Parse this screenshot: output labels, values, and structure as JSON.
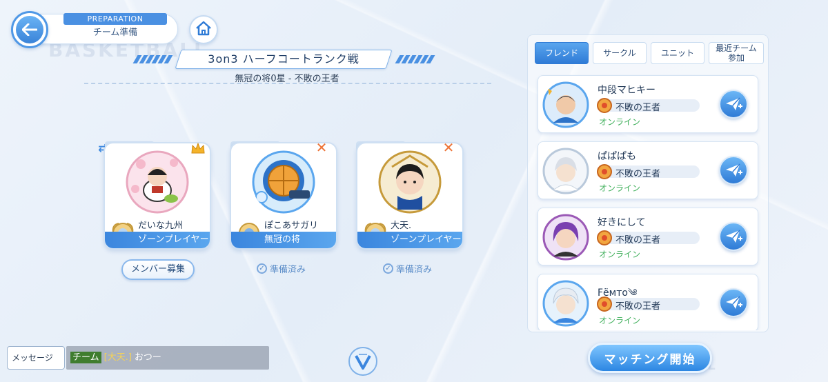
{
  "header": {
    "section_tag": "PREPARATION",
    "section_name": "チーム準備"
  },
  "match": {
    "title": "3on3 ハーフコートランク戦",
    "subtitle": "無冠の将0星 - 不敗の王者"
  },
  "members": [
    {
      "position": "C",
      "name": "だいな九州",
      "title": "ゾーンプレイヤー",
      "leader": true,
      "swap": true
    },
    {
      "position": "PF",
      "name": "ぽこあサガリ",
      "title": "無冠の将",
      "status": "準備済み"
    },
    {
      "position": "SG",
      "name": "大天.",
      "title": "ゾーンプレイヤー",
      "status": "準備済み"
    }
  ],
  "recruit_label": "メンバー募集",
  "friend_panel": {
    "tabs": [
      "フレンド",
      "サークル",
      "ユニット",
      "最近チーム参加"
    ],
    "active_tab": "フレンド",
    "friends": [
      {
        "name": "中段マヒキー",
        "title": "不敗の王者",
        "status": "オンライン"
      },
      {
        "name": "ぱぱぱも",
        "title": "不敗の王者",
        "status": "オンライン"
      },
      {
        "name": "好きにして",
        "title": "不敗の王者",
        "status": "オンライン"
      },
      {
        "name": "Fёмтo༄",
        "title": "不敗の王者",
        "status": "オンライン"
      }
    ]
  },
  "match_button_label": "マッチング開始",
  "chat": {
    "button_label": "メッセージ",
    "channel": "チーム",
    "sender": "[大天.]",
    "text": "おつー"
  },
  "colors": {
    "accent": "#3f8ae0",
    "online": "#3cae58",
    "cancel": "#ee7335"
  }
}
